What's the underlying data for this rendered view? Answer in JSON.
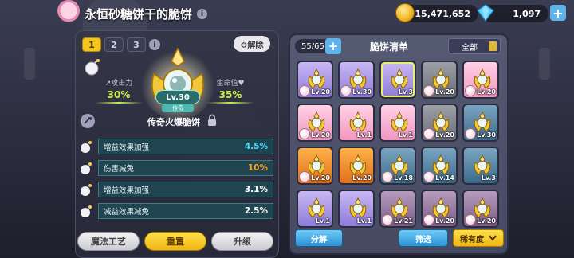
{
  "header": {
    "title": "永恒砂糖饼干的脆饼",
    "info": "i",
    "coins": "15,471,652",
    "gems": "1,097",
    "plus": "+"
  },
  "left": {
    "tabs": [
      "1",
      "2",
      "3"
    ],
    "tab_info": "i",
    "unequip": "⚙解除",
    "attack_label": "↗攻击力",
    "attack_value": "30%",
    "hp_label": "生命值♥",
    "hp_value": "35%",
    "level": "Lv.30",
    "rarity": "传奇",
    "item_name": "传奇火爆脆饼",
    "substats": [
      {
        "name": "增益效果加强",
        "value": "4.5%",
        "color": "#4fd8ff"
      },
      {
        "name": "伤害减免",
        "value": "10%",
        "color": "#ffa42a"
      },
      {
        "name": "增益效果加强",
        "value": "3.1%",
        "color": "#ffffff"
      },
      {
        "name": "减益效果减免",
        "value": "2.5%",
        "color": "#ffffff"
      }
    ],
    "buttons": {
      "magic": "魔法工艺",
      "reset": "重置",
      "upgrade": "升级"
    }
  },
  "right": {
    "count": "55/65",
    "add": "+",
    "title": "脆饼清单",
    "filter": "全部",
    "slots": [
      {
        "color": "purple",
        "level": "Lv.20",
        "cookie": true,
        "equipped": false
      },
      {
        "color": "purple",
        "level": "Lv.30",
        "cookie": true,
        "equipped": false
      },
      {
        "color": "purple",
        "level": "Lv.3",
        "cookie": false,
        "equipped": true
      },
      {
        "color": "grey",
        "level": "Lv.20",
        "cookie": true,
        "equipped": false
      },
      {
        "color": "pink",
        "level": "Lv.20",
        "cookie": true,
        "equipped": false
      },
      {
        "color": "pink",
        "level": "Lv.20",
        "cookie": true,
        "equipped": false
      },
      {
        "color": "pink",
        "level": "Lv.1",
        "cookie": false,
        "equipped": false
      },
      {
        "color": "pink",
        "level": "Lv.1",
        "cookie": false,
        "equipped": false
      },
      {
        "color": "grey",
        "level": "Lv.20",
        "cookie": true,
        "equipped": false
      },
      {
        "color": "teal",
        "level": "Lv.30",
        "cookie": true,
        "equipped": false
      },
      {
        "color": "orange",
        "level": "Lv.20",
        "cookie": true,
        "equipped": false
      },
      {
        "color": "orange",
        "level": "Lv.20",
        "cookie": false,
        "equipped": false
      },
      {
        "color": "teal",
        "level": "Lv.18",
        "cookie": true,
        "equipped": false
      },
      {
        "color": "teal",
        "level": "Lv.14",
        "cookie": true,
        "equipped": false
      },
      {
        "color": "teal",
        "level": "Lv.3",
        "cookie": false,
        "equipped": false
      },
      {
        "color": "purple",
        "level": "Lv.1",
        "cookie": false,
        "equipped": false
      },
      {
        "color": "purple",
        "level": "Lv.1",
        "cookie": false,
        "equipped": false
      },
      {
        "color": "rose",
        "level": "Lv.21",
        "cookie": true,
        "equipped": false
      },
      {
        "color": "rose",
        "level": "Lv.20",
        "cookie": true,
        "equipped": false
      },
      {
        "color": "rose",
        "level": "Lv.20",
        "cookie": true,
        "equipped": false
      }
    ],
    "buttons": {
      "dismantle": "分解",
      "filter": "筛选",
      "sort": "稀有度"
    }
  }
}
